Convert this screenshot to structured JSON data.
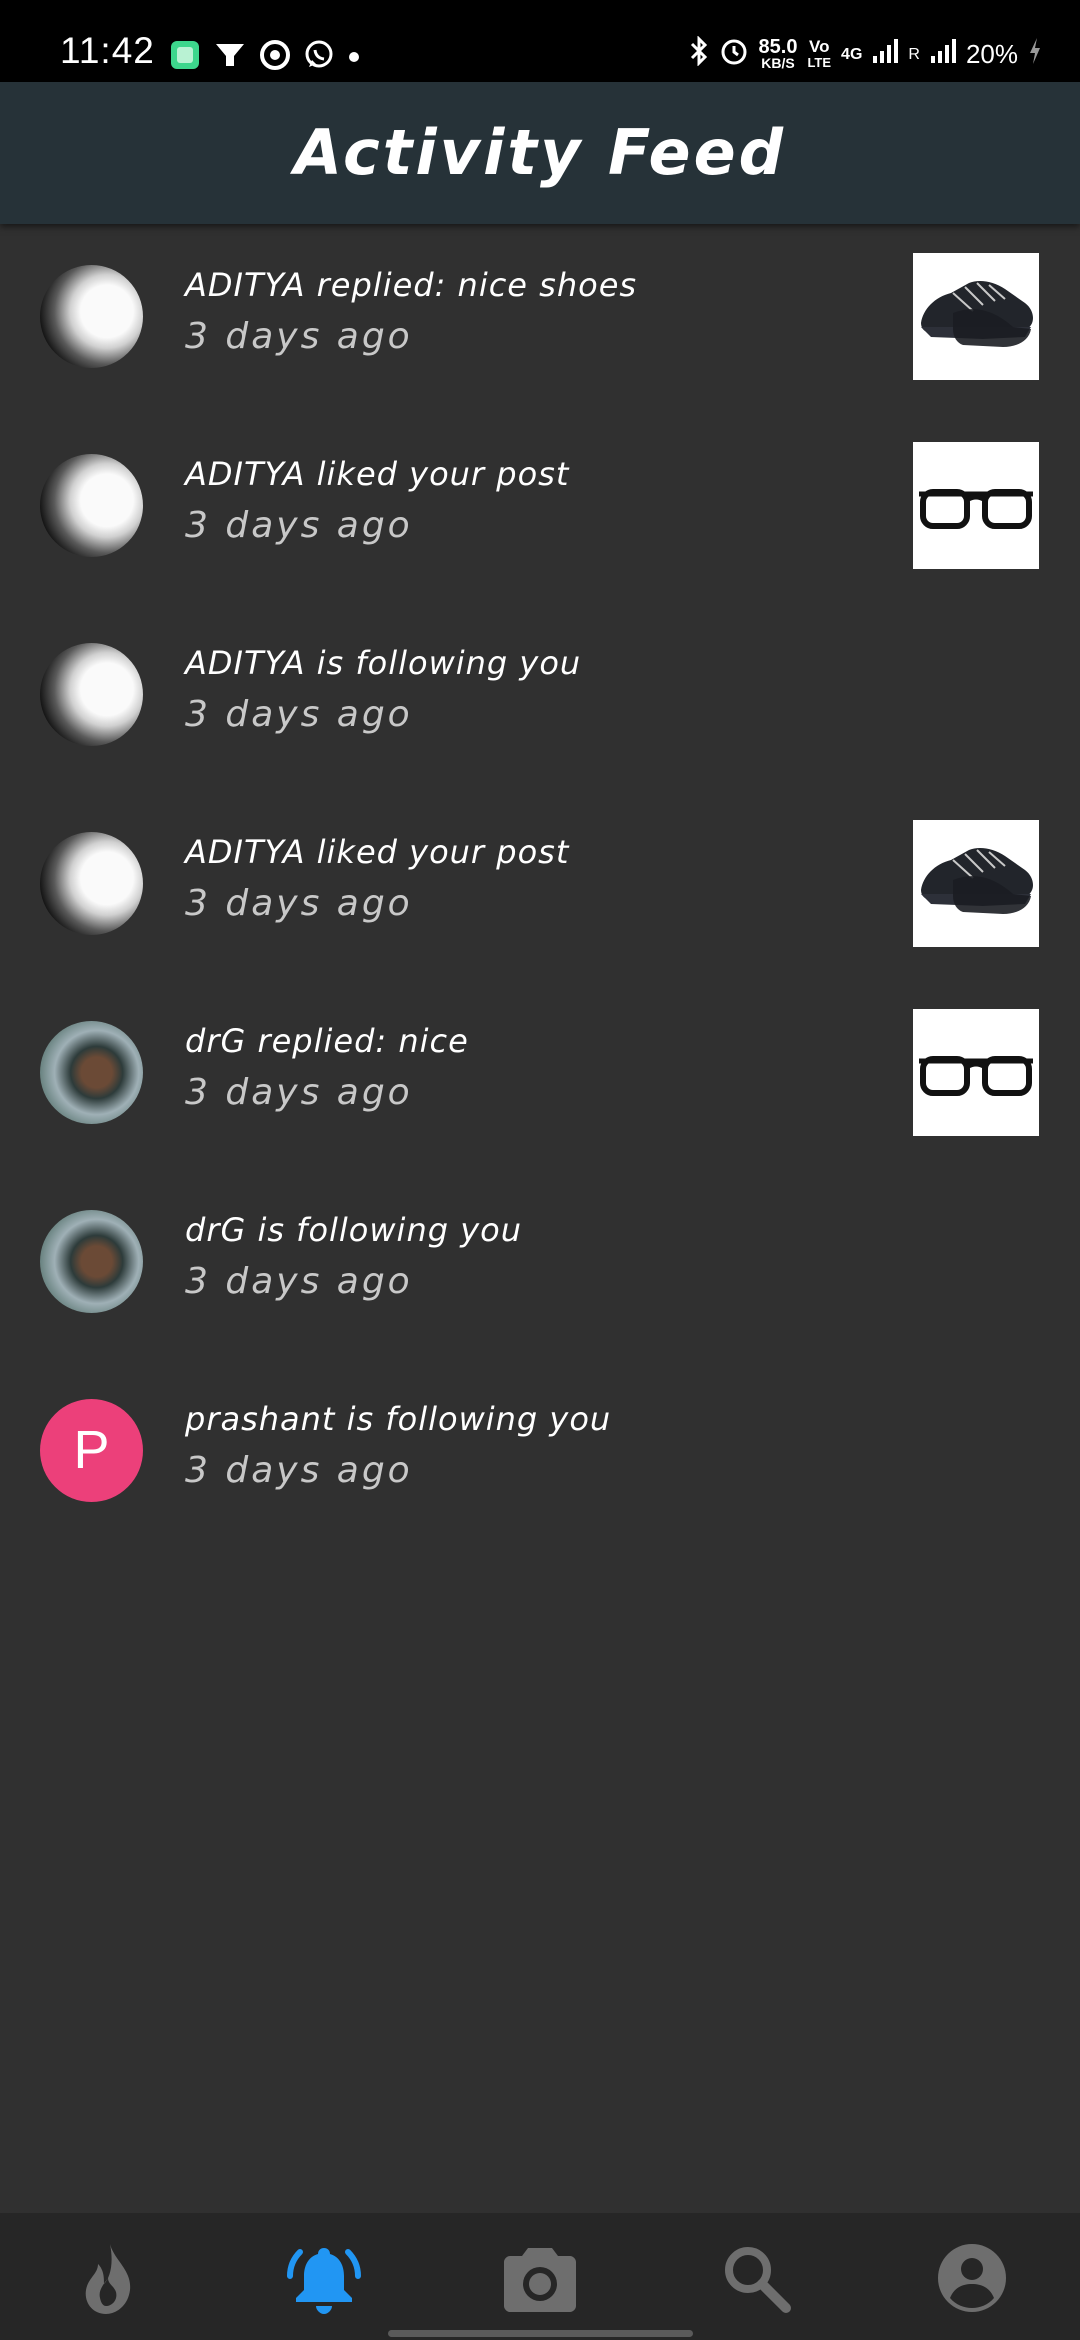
{
  "status_bar": {
    "time": "11:42",
    "speed_value": "85.0",
    "speed_unit": "KB/S",
    "volte_top": "Vo",
    "volte_bottom": "LTE",
    "network": "4G",
    "roaming": "R",
    "battery": "20%",
    "icons": [
      "app-icon",
      "notification-icon",
      "chrome-icon",
      "whatsapp-icon",
      "dot-icon",
      "bluetooth-icon",
      "alarm-icon",
      "signal-icon",
      "battery-charging-icon"
    ]
  },
  "header": {
    "title": "Activity Feed"
  },
  "feed": {
    "items": [
      {
        "message": "ADITYA replied: nice shoes",
        "time": "3 days ago",
        "avatar": "aditya",
        "thumbnail": "shoe"
      },
      {
        "message": "ADITYA liked your post",
        "time": "3 days ago",
        "avatar": "aditya",
        "thumbnail": "glasses"
      },
      {
        "message": "ADITYA is following you",
        "time": "3 days ago",
        "avatar": "aditya",
        "thumbnail": ""
      },
      {
        "message": "ADITYA liked your post",
        "time": "3 days ago",
        "avatar": "aditya",
        "thumbnail": "shoe"
      },
      {
        "message": "drG replied: nice",
        "time": "3 days ago",
        "avatar": "drg",
        "thumbnail": "glasses"
      },
      {
        "message": "drG is following you",
        "time": "3 days ago",
        "avatar": "drg",
        "thumbnail": ""
      },
      {
        "message": "prashant is following you",
        "time": "3 days ago",
        "avatar_letter": "P",
        "avatar_color": "#ec407a",
        "thumbnail": ""
      }
    ]
  },
  "bottom_nav": {
    "items": [
      {
        "icon": "flame-icon",
        "active": false
      },
      {
        "icon": "notifications-icon",
        "active": true
      },
      {
        "icon": "camera-icon",
        "active": false
      },
      {
        "icon": "search-icon",
        "active": false
      },
      {
        "icon": "account-icon",
        "active": false
      }
    ],
    "active_color": "#2196f3",
    "inactive_color": "#6e6e6e"
  },
  "colors": {
    "background": "#303030",
    "app_bar": "#263238",
    "nav_bar": "#262626"
  }
}
